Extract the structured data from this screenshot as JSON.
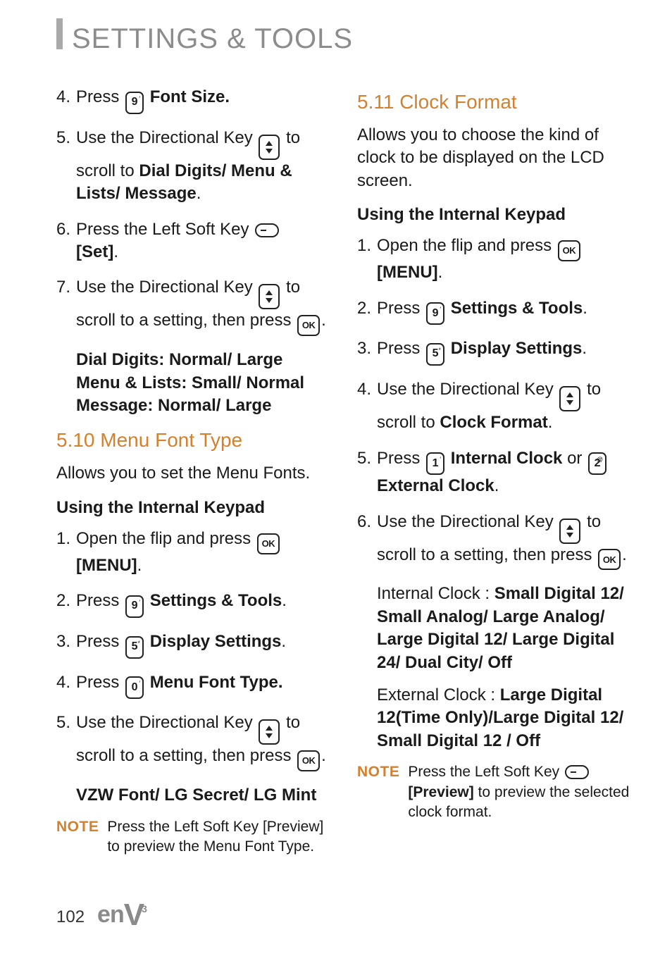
{
  "header": {
    "title": "SETTINGS & TOOLS"
  },
  "left": {
    "cont_steps": {
      "s4": {
        "n": "4.",
        "a": "Press ",
        "b": " Font Size."
      },
      "s5": {
        "n": "5.",
        "a": "Use the Directional Key ",
        "b": " to scroll to ",
        "c": "Dial Digits/ Menu & Lists/ Message",
        "d": "."
      },
      "s6": {
        "n": "6.",
        "a": "Press the Left Soft Key ",
        "b": " [Set]",
        "c": "."
      },
      "s7": {
        "n": "7.",
        "a": "Use the Directional Key ",
        "b": " to scroll to a setting, then press ",
        "c": "."
      }
    },
    "settings_block": {
      "l1": "Dial Digits: Normal/ Large",
      "l2": "Menu & Lists: Small/ Normal",
      "l3": "Message: Normal/ Large"
    },
    "sec10": {
      "title": "5.10 Menu Font Type",
      "intro": "Allows you to set the Menu Fonts.",
      "sub": "Using the Internal Keypad",
      "s1": {
        "n": "1.",
        "a": "Open the flip and press ",
        "b": " [MENU]",
        "c": "."
      },
      "s2": {
        "n": "2.",
        "a": "Press ",
        "b": " Settings & Tools",
        "c": "."
      },
      "s3": {
        "n": "3.",
        "a": "Press ",
        "b": " Display Settings",
        "c": "."
      },
      "s4": {
        "n": "4.",
        "a": "Press ",
        "b": " Menu Font Type."
      },
      "s5": {
        "n": "5.",
        "a": "Use the Directional Key ",
        "b": " to scroll to a setting, then press ",
        "c": "."
      },
      "options": "VZW Font/ LG Secret/ LG Mint",
      "note_label": "NOTE",
      "note_body": "Press the Left Soft Key [Preview] to preview the Menu Font Type."
    }
  },
  "right": {
    "sec11": {
      "title": "5.11 Clock Format",
      "intro": "Allows you to choose the kind of clock to be displayed on the LCD screen.",
      "sub": "Using the Internal Keypad",
      "s1": {
        "n": "1.",
        "a": "Open the flip and press ",
        "b": " [MENU]",
        "c": "."
      },
      "s2": {
        "n": "2.",
        "a": "Press ",
        "b": " Settings & Tools",
        "c": "."
      },
      "s3": {
        "n": "3.",
        "a": "Press ",
        "b": " Display Settings",
        "c": "."
      },
      "s4": {
        "n": "4.",
        "a": "Use the Directional Key ",
        "b": " to scroll to ",
        "c": "Clock Format",
        "d": "."
      },
      "s5": {
        "n": "5.",
        "a": "Press ",
        "b": " Internal Clock",
        "c": " or ",
        "d": " External Clock",
        "e": "."
      },
      "s6": {
        "n": "6.",
        "a": "Use the Directional Key ",
        "b": " to scroll to a setting, then press ",
        "c": "."
      },
      "internal_label": "Internal Clock : ",
      "internal_opts": "Small Digital 12/ Small Analog/ Large Analog/ Large Digital 12/ Large Digital 24/ Dual City/ Off",
      "external_label": "External Clock : ",
      "external_opts": "Large Digital 12(Time Only)/Large Digital 12/ Small Digital 12 / Off",
      "note_label": "NOTE",
      "note_a": "Press the Left Soft Key ",
      "note_b": " [Preview]",
      "note_c": " to preview the selected clock format."
    }
  },
  "footer": {
    "page": "102",
    "brand_a": "en",
    "brand_b": "V",
    "brand_sup": "3"
  }
}
